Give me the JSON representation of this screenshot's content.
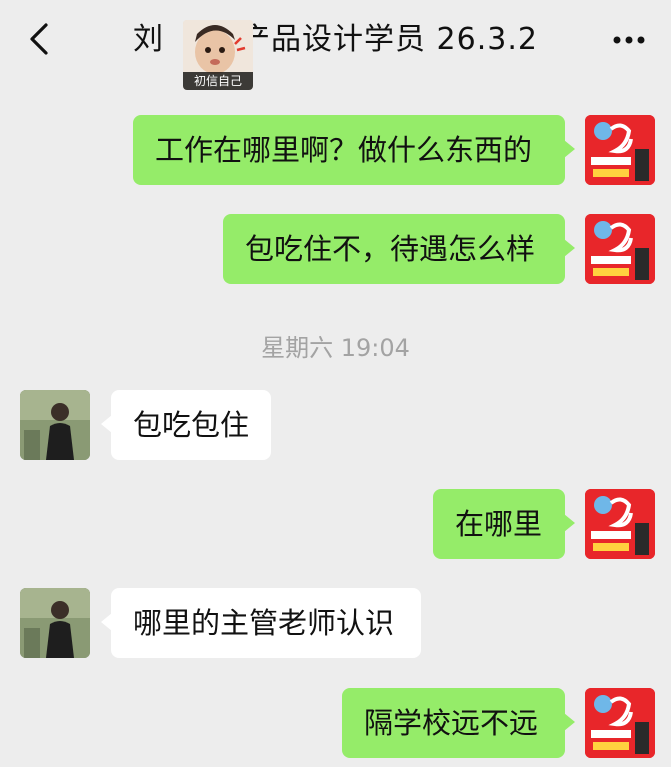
{
  "header": {
    "title_part1": "刘",
    "title_part2": "产品设计学员 26.3.2",
    "sticker_caption": "初信自己",
    "back_icon": "chevron-left-icon",
    "more_icon": "more-horizontal-icon"
  },
  "messages": [
    {
      "sender": "me",
      "text": "工作在哪里啊？做什么东西的"
    },
    {
      "sender": "me",
      "text": "包吃住不，待遇怎么样"
    },
    {
      "sender": "other",
      "text": "包吃包住"
    },
    {
      "sender": "me",
      "text": "在哪里"
    },
    {
      "sender": "other",
      "text": "哪里的主管老师认识"
    },
    {
      "sender": "me",
      "text": "隔学校远不远"
    }
  ],
  "timestamp": "星期六 19:04",
  "colors": {
    "background": "#ededed",
    "my_bubble": "#95ec69",
    "other_bubble": "#ffffff",
    "timestamp_text": "#a3a3a3"
  },
  "avatars": {
    "me": "red-poster-avatar",
    "other": "person-photo-avatar"
  }
}
